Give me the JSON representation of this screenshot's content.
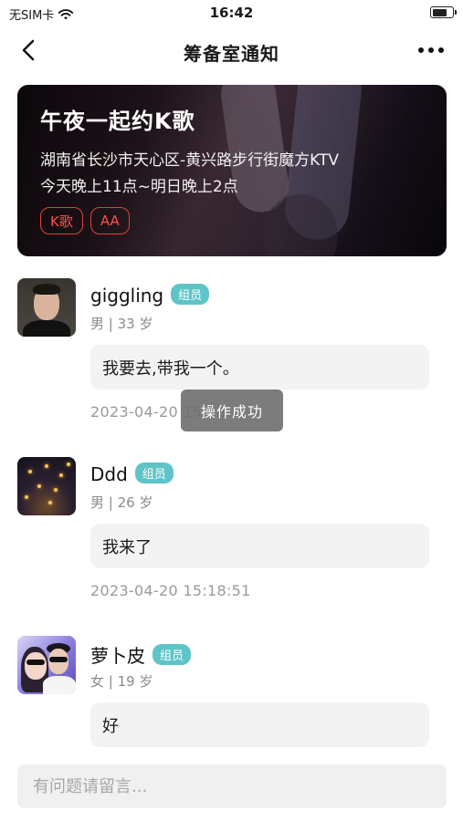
{
  "status_bar": {
    "carrier": "无SIM卡",
    "time": "16:42",
    "battery_level": 0.75,
    "wifi_icon": "wifi-icon"
  },
  "nav": {
    "title": "筹备室通知",
    "back_icon": "chevron-left-icon",
    "more_icon": "more-horizontal-icon"
  },
  "event": {
    "title": "午夜一起约K歌",
    "address": "湖南省长沙市天心区-黄兴路步行街魔方KTV",
    "time": "今天晚上11点~明日晚上2点",
    "tags": [
      "K歌",
      "AA"
    ],
    "tag_color": "#e0403c"
  },
  "comments": [
    {
      "name": "giggling",
      "role": "组员",
      "meta": "男 | 33 岁",
      "message": "我要去,带我一个。",
      "time": "2023-04-20 15:18:51"
    },
    {
      "name": "Ddd",
      "role": "组员",
      "meta": "男 | 26 岁",
      "message": "我来了",
      "time": "2023-04-20 15:18:51"
    },
    {
      "name": "萝卜皮",
      "role": "组员",
      "meta": "女 | 19 岁",
      "message": "好",
      "time": ""
    }
  ],
  "toast": {
    "text": "操作成功"
  },
  "input": {
    "placeholder": "有问题请留言..."
  },
  "colors": {
    "badge": "#5fc4c7",
    "bubble": "#f3f3f3",
    "toast": "#6e6e6e"
  }
}
